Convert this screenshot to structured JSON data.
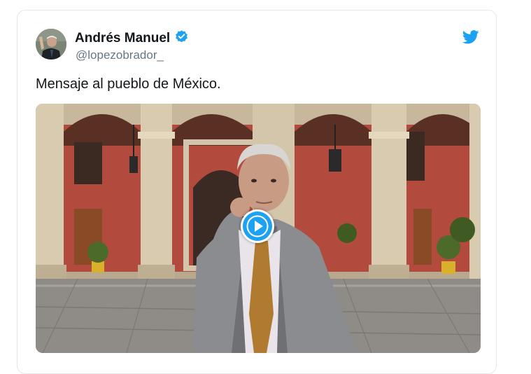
{
  "tweet": {
    "author_name": "Andrés Manuel",
    "handle": "@lopezobrador_",
    "verified": true,
    "text": "Mensaje al pueblo de México."
  },
  "media": {
    "type": "video",
    "play_icon": "play-icon"
  },
  "icons": {
    "brand": "twitter-bird-icon",
    "verified": "verified-badge-icon"
  },
  "colors": {
    "accent": "#1da1f2",
    "text_primary": "#14171a",
    "text_secondary": "#657786",
    "border": "#e1e8ed"
  }
}
